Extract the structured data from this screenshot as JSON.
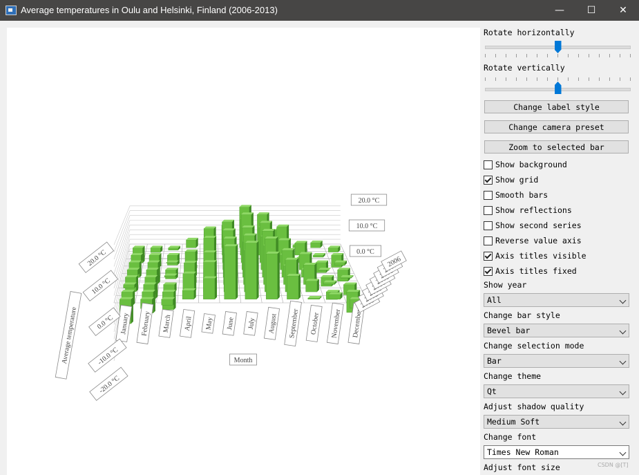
{
  "window": {
    "title": "Average temperatures in Oulu and Helsinki, Finland (2006-2013)",
    "min_glyph": "—",
    "max_glyph": "☐",
    "close_glyph": "✕"
  },
  "chart_data": {
    "type": "bar",
    "categories": [
      "January",
      "February",
      "March",
      "April",
      "May",
      "June",
      "July",
      "August",
      "September",
      "October",
      "November",
      "December"
    ],
    "years": [
      "2006",
      "2007",
      "2008",
      "2009",
      "2010",
      "2011",
      "2012",
      "2013"
    ],
    "value_ticks": [
      "20.0 °C",
      "10.0 °C",
      "0.0 °C",
      "-10.0 °C",
      "-20.0 °C"
    ],
    "right_value_ticks": [
      "20.0 °C",
      "10.0 °C",
      "0.0 °C"
    ],
    "xlabel": "Month",
    "ylabel": "Average temperature",
    "ylim": [
      -20,
      20
    ],
    "bar_color": "#6abf40",
    "bar_side_color": "#3f8a24",
    "bar_top_color": "#8fd866"
  },
  "controls": {
    "rotate_h_label": "Rotate horizontally",
    "rotate_v_label": "Rotate vertically",
    "rotate_h_value": 0.5,
    "rotate_v_value": 0.5,
    "buttons": [
      "Change label style",
      "Change camera preset",
      "Zoom to selected bar"
    ],
    "checkboxes": [
      {
        "label": "Show background",
        "checked": false
      },
      {
        "label": "Show grid",
        "checked": true
      },
      {
        "label": "Smooth bars",
        "checked": false
      },
      {
        "label": "Show reflections",
        "checked": false
      },
      {
        "label": "Show second series",
        "checked": false
      },
      {
        "label": "Reverse value axis",
        "checked": false
      },
      {
        "label": "Axis titles visible",
        "checked": true
      },
      {
        "label": "Axis titles fixed",
        "checked": true
      }
    ],
    "show_year_label": "Show year",
    "show_year_value": "All",
    "bar_style_label": "Change bar style",
    "bar_style_value": "Bevel bar",
    "selection_mode_label": "Change selection mode",
    "selection_mode_value": "Bar",
    "theme_label": "Change theme",
    "theme_value": "Qt",
    "shadow_label": "Adjust shadow quality",
    "shadow_value": "Medium Soft",
    "font_label": "Change font",
    "font_value": "Times New Roman",
    "font_size_label": "Adjust font size"
  },
  "watermark": "CSDN @[T]"
}
